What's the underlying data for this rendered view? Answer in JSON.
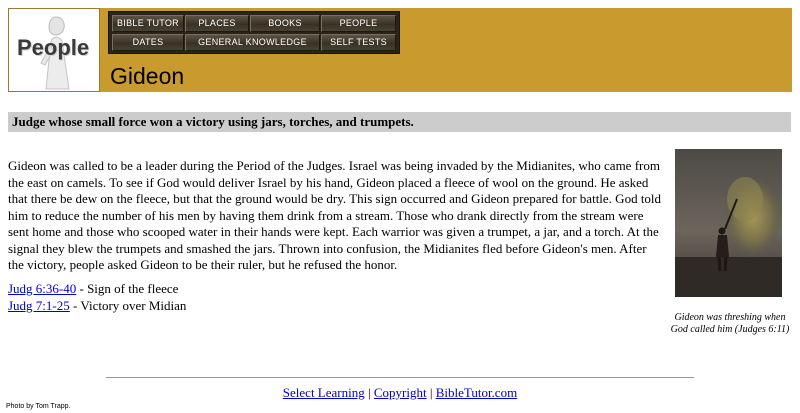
{
  "header": {
    "logo_word": "People",
    "page_title": "Gideon",
    "nav": [
      {
        "label": "Bible Tutor"
      },
      {
        "label": "Places"
      },
      {
        "label": "Books"
      },
      {
        "label": "People"
      },
      {
        "label": "Dates"
      },
      {
        "label": "General Knowledge"
      },
      {
        "label": "Self Tests"
      }
    ]
  },
  "summary": "Judge whose small force won a victory using jars, torches, and trumpets.",
  "body": "Gideon was called to be a leader during the Period of the Judges.  Israel was being invaded by the Midianites, who came from the east on camels.  To see if God would deliver Israel by his hand, Gideon placed a fleece of wool on the ground.  He asked that there be dew on the fleece, but that the ground would be dry.  This sign occurred and Gideon prepared for battle.  God told him to reduce the number of his men by having them drink from a stream.  Those who drank directly from the stream were sent home and those who scooped water in their hands were kept.  Each warrior was given a trumpet, a jar, and a torch.  At the signal they blew the trumpets and smashed the jars.  Thrown into confusion, the Midianites fled before Gideon's men. After the victory, people asked Gideon to be their ruler, but he refused the honor.",
  "references": [
    {
      "link": "Judg 6:36-40",
      "text": " - Sign of the fleece"
    },
    {
      "link": "Judg 7:1-25",
      "text": " - Victory over Midian"
    }
  ],
  "photo": {
    "caption": "Gideon was threshing when God called him (Judges 6:11)"
  },
  "footer": {
    "links": [
      "Select Learning",
      "Copyright",
      "BibleTutor.com"
    ],
    "separator": " | ",
    "credit": "Photo by Tom Trapp."
  },
  "colors": {
    "banner": "#c99a2e",
    "summary_bar": "#cccccc",
    "link": "#0000cc"
  }
}
